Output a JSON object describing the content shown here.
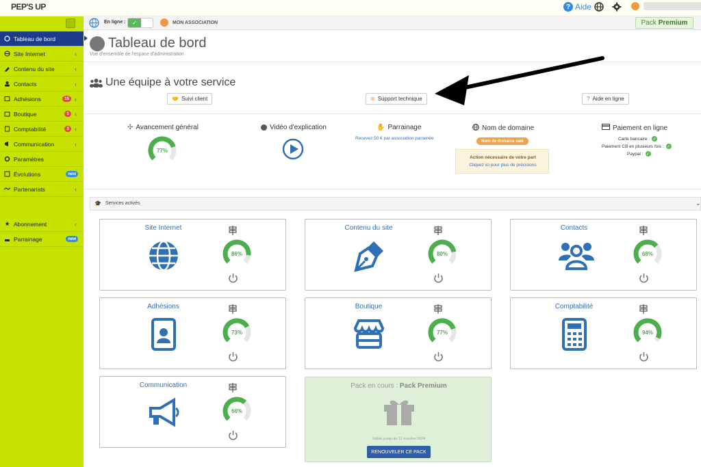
{
  "topbar": {
    "logo": "PEP'S UP",
    "help_label": "Aide"
  },
  "sidebar": {
    "items": [
      {
        "label": "Tableau de bord"
      },
      {
        "label": "Site Internet"
      },
      {
        "label": "Contenu du site"
      },
      {
        "label": "Contacts"
      },
      {
        "label": "Adhésions",
        "badge": "15"
      },
      {
        "label": "Boutique",
        "badge": "1"
      },
      {
        "label": "Comptabilité",
        "badge": "3"
      },
      {
        "label": "Communication"
      },
      {
        "label": "Paramètres"
      },
      {
        "label": "Évolutions",
        "badge": "new"
      },
      {
        "label": "Partenariats"
      },
      {
        "label": "Abonnement"
      },
      {
        "label": "Parrainage",
        "badge": "new"
      }
    ]
  },
  "subbar": {
    "online_label": "En ligne :",
    "assoc_name": "MON ASSOCIATION",
    "pack_prefix": "Pack",
    "pack_name": "Premium"
  },
  "page": {
    "title": "Tableau de bord",
    "subtitle": "Vue d'ensemble de l'espace d'administration"
  },
  "team": {
    "title": "Une équipe à votre service",
    "buttons": [
      "Suivi client",
      "Support technique",
      "Aide en ligne"
    ]
  },
  "stats": {
    "progress_title": "Avancement général",
    "progress_value": 77,
    "video_title": "Vidéo d'explication",
    "referral_title": "Parrainage",
    "referral_text": "Recevez 50 € par association parrainée",
    "domain_title": "Nom de domaine",
    "domain_badge": "Nom de domaine salé",
    "domain_action": "Action nécessaire de votre part",
    "domain_link": "Cliquez ici pour plus de précisions",
    "payment_title": "Paiement en ligne",
    "payment_lines": [
      "Carte bancaire :",
      "Paiement CB en plusieurs fois :",
      "Paypal :"
    ]
  },
  "services": {
    "header": "Services activés",
    "cards": [
      {
        "title": "Site Internet",
        "value": 86,
        "icon": "globe-icon"
      },
      {
        "title": "Contenu du site",
        "value": 80,
        "icon": "pen-nib-icon"
      },
      {
        "title": "Contacts",
        "value": 68,
        "icon": "users-icon"
      },
      {
        "title": "Adhésions",
        "value": 73,
        "icon": "id-badge-icon"
      },
      {
        "title": "Boutique",
        "value": 77,
        "icon": "store-icon"
      },
      {
        "title": "Comptabilité",
        "value": 94,
        "icon": "calculator-icon"
      },
      {
        "title": "Communication",
        "value": 66,
        "icon": "megaphone-icon"
      }
    ],
    "pack": {
      "prefix": "Pack en cours :",
      "name": "Pack Premium",
      "valid": "Valide jusqu'au 11 octobre 2024",
      "renew": "RENOUVELER CE PACK"
    }
  },
  "colors": {
    "sidebar": "#c5e200",
    "active": "#1c3b8a",
    "accent_blue": "#2f6fb5",
    "gauge_green": "#4cae4c"
  }
}
